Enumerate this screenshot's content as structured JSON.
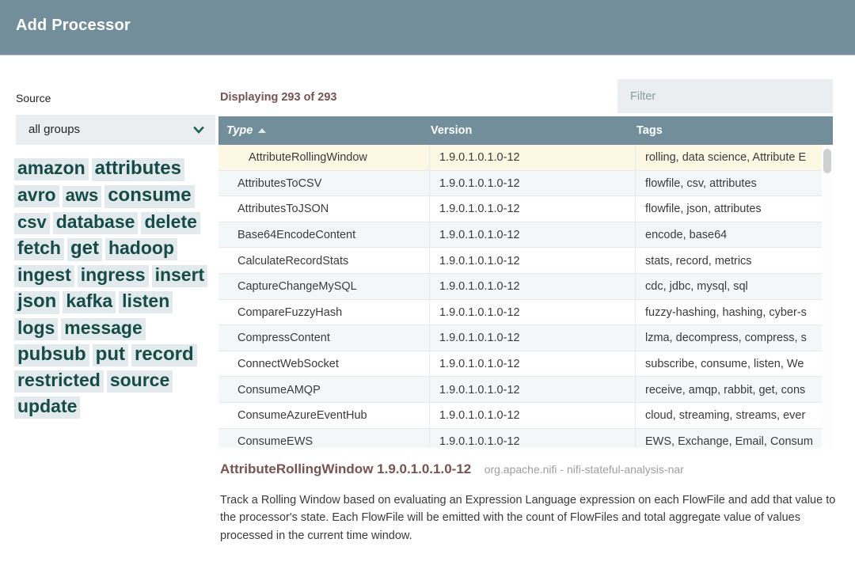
{
  "dialog": {
    "title": "Add Processor"
  },
  "sidebar": {
    "source_label": "Source",
    "source_selected": "all groups",
    "chevron_icon": "chevron-down-icon",
    "tags": [
      {
        "label": "amazon",
        "size": "s3"
      },
      {
        "label": "attributes",
        "size": "s4"
      },
      {
        "label": "avro",
        "size": "s3"
      },
      {
        "label": "aws",
        "size": "s2"
      },
      {
        "label": "consume",
        "size": "s4"
      },
      {
        "label": "csv",
        "size": "s2"
      },
      {
        "label": "database",
        "size": "s3"
      },
      {
        "label": "delete",
        "size": "s3"
      },
      {
        "label": "fetch",
        "size": "s3"
      },
      {
        "label": "get",
        "size": "s4"
      },
      {
        "label": "hadoop",
        "size": "s3"
      },
      {
        "label": "ingest",
        "size": "s3"
      },
      {
        "label": "ingress",
        "size": "s3"
      },
      {
        "label": "insert",
        "size": "s3"
      },
      {
        "label": "json",
        "size": "s4"
      },
      {
        "label": "kafka",
        "size": "s3"
      },
      {
        "label": "listen",
        "size": "s3"
      },
      {
        "label": "logs",
        "size": "s3"
      },
      {
        "label": "message",
        "size": "s3"
      },
      {
        "label": "pubsub",
        "size": "s4"
      },
      {
        "label": "put",
        "size": "s4"
      },
      {
        "label": "record",
        "size": "s4"
      },
      {
        "label": "restricted",
        "size": "s3"
      },
      {
        "label": "source",
        "size": "s3"
      },
      {
        "label": "update",
        "size": "s3"
      }
    ]
  },
  "main": {
    "displaying": "Displaying 293 of 293",
    "filter_placeholder": "Filter",
    "filter_value": "",
    "columns": {
      "type": "Type",
      "version": "Version",
      "tags": "Tags"
    },
    "sort": {
      "column": "Type",
      "direction": "asc",
      "icon": "sort-ascending-icon"
    },
    "scrollbar_icon": "vertical-scrollbar",
    "rows": [
      {
        "type": "AttributeRollingWindow",
        "version": "1.9.0.1.0.1.0-12",
        "tags": "rolling, data science, Attribute E",
        "selected": true
      },
      {
        "type": "AttributesToCSV",
        "version": "1.9.0.1.0.1.0-12",
        "tags": "flowfile, csv, attributes",
        "selected": false
      },
      {
        "type": "AttributesToJSON",
        "version": "1.9.0.1.0.1.0-12",
        "tags": "flowfile, json, attributes",
        "selected": false
      },
      {
        "type": "Base64EncodeContent",
        "version": "1.9.0.1.0.1.0-12",
        "tags": "encode, base64",
        "selected": false
      },
      {
        "type": "CalculateRecordStats",
        "version": "1.9.0.1.0.1.0-12",
        "tags": "stats, record, metrics",
        "selected": false
      },
      {
        "type": "CaptureChangeMySQL",
        "version": "1.9.0.1.0.1.0-12",
        "tags": "cdc, jdbc, mysql, sql",
        "selected": false
      },
      {
        "type": "CompareFuzzyHash",
        "version": "1.9.0.1.0.1.0-12",
        "tags": "fuzzy-hashing, hashing, cyber-s",
        "selected": false
      },
      {
        "type": "CompressContent",
        "version": "1.9.0.1.0.1.0-12",
        "tags": "lzma, decompress, compress, s",
        "selected": false
      },
      {
        "type": "ConnectWebSocket",
        "version": "1.9.0.1.0.1.0-12",
        "tags": "subscribe, consume, listen, We",
        "selected": false
      },
      {
        "type": "ConsumeAMQP",
        "version": "1.9.0.1.0.1.0-12",
        "tags": "receive, amqp, rabbit, get, cons",
        "selected": false
      },
      {
        "type": "ConsumeAzureEventHub",
        "version": "1.9.0.1.0.1.0-12",
        "tags": "cloud, streaming, streams, ever",
        "selected": false
      },
      {
        "type": "ConsumeEWS",
        "version": "1.9.0.1.0.1.0-12",
        "tags": "EWS, Exchange, Email, Consum",
        "selected": false
      }
    ]
  },
  "detail": {
    "title": "AttributeRollingWindow 1.9.0.1.0.1.0-12",
    "subtitle": "org.apache.nifi - nifi-stateful-analysis-nar",
    "description": "Track a Rolling Window based on evaluating an Expression Language expression on each FlowFile and add that value to the processor's state. Each FlowFile will be emitted with the count of FlowFiles and total aggregate value of values processed in the current time window."
  },
  "colors": {
    "header_bar": "#728e9b",
    "accent_text": "#775351",
    "tag_text": "#164b47",
    "tag_bg": "#e3eaed",
    "selected_row": "#fcf8e3"
  }
}
